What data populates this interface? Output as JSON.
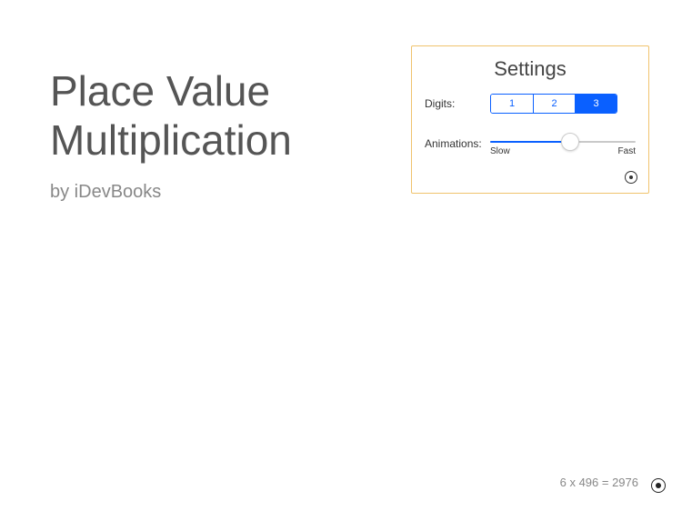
{
  "title": {
    "line1": "Place Value",
    "line2": "Multiplication"
  },
  "byline": "by iDevBooks",
  "settings": {
    "heading": "Settings",
    "digits_label": "Digits:",
    "digits_options": [
      "1",
      "2",
      "3"
    ],
    "digits_selected_index": 2,
    "animations_label": "Animations:",
    "animations_min_label": "Slow",
    "animations_max_label": "Fast",
    "animations_value_percent": 55
  },
  "footer": {
    "equation": "6 x 496 = 2976"
  },
  "colors": {
    "accent": "#0a60ff",
    "panel_border": "#f0c36d"
  }
}
